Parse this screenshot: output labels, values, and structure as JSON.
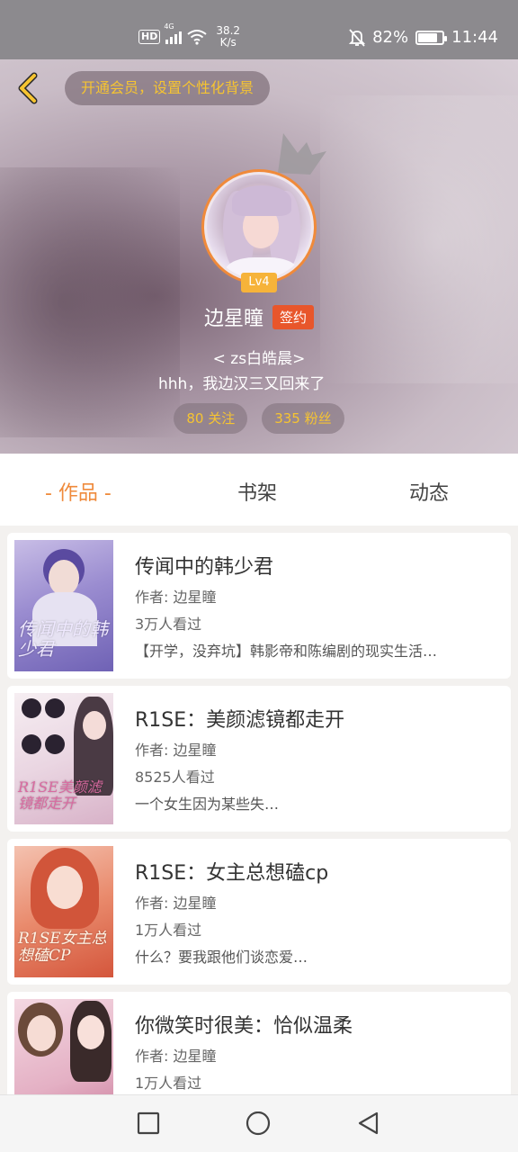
{
  "status_bar": {
    "hd": "HD",
    "network": "4G",
    "speed_value": "38.2",
    "speed_unit": "K/s",
    "battery": "82%",
    "battery_level": 0.82,
    "time": "11:44"
  },
  "header": {
    "vip_text": "开通会员，设置个性化背景",
    "level": "Lv4",
    "name": "边星瞳",
    "signed_label": "签约",
    "subtitle_1": "< zs白皓晨>",
    "subtitle_2": "hhh，我边汉三又回来了",
    "following": "80 关注",
    "followers": "335 粉丝"
  },
  "tabs": {
    "works": "- 作品 -",
    "shelf": "书架",
    "activity": "动态"
  },
  "books": [
    {
      "title": "传闻中的韩少君",
      "author": "作者: 边星瞳",
      "reads": "3万人看过",
      "desc": "【开学，没弃坑】韩影帝和陈编剧的现实生活…",
      "cover_text": "传闻中的韩少君"
    },
    {
      "title": "R1SE：美颜滤镜都走开",
      "author": "作者: 边星瞳",
      "reads": "8525人看过",
      "desc": "一个女生因为某些失…",
      "cover_text": "R1SE美颜滤镜都走开"
    },
    {
      "title": "R1SE：女主总想磕cp",
      "author": "作者: 边星瞳",
      "reads": "1万人看过",
      "desc": "什么？要我跟他们谈恋爱…",
      "cover_text": "R1SE女主总想磕CP"
    },
    {
      "title": "你微笑时很美：恰似温柔",
      "author": "作者: 边星瞳",
      "reads": "1万人看过",
      "desc": "",
      "cover_text": ""
    }
  ],
  "colors": {
    "accent": "#ef8a3b",
    "vip_text": "#f6c431",
    "signed_bg": "#e8562b",
    "level_bg": "#f6b33a"
  },
  "icons": {
    "back": "chevron-left-icon",
    "crown": "crown-icon",
    "nav_recent": "square-icon",
    "nav_home": "circle-icon",
    "nav_back": "triangle-back-icon"
  }
}
